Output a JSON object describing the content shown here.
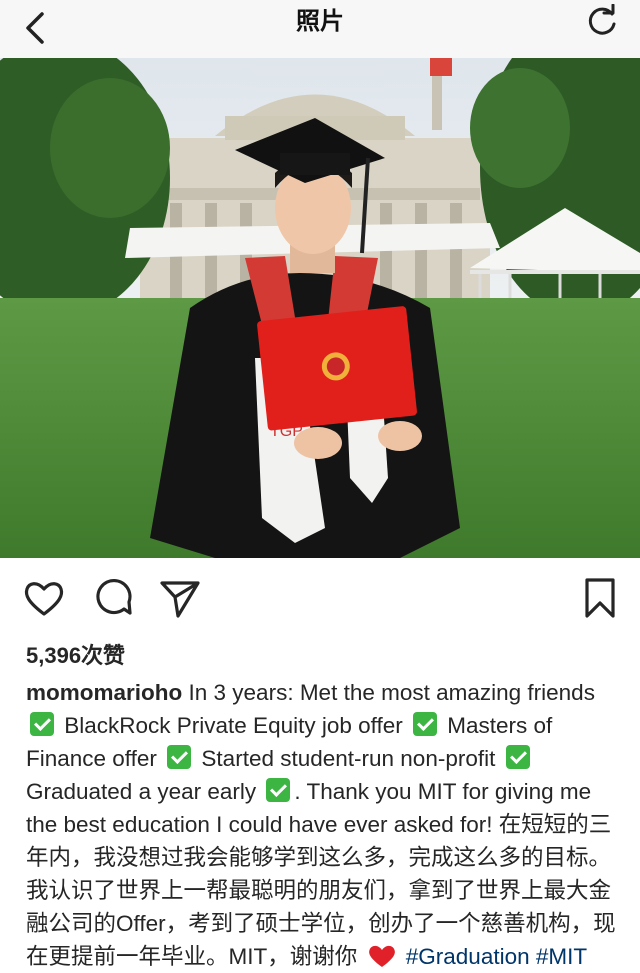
{
  "nav": {
    "title": "照片",
    "back_icon": "chevron-left-icon",
    "refresh_icon": "refresh-icon"
  },
  "photo": {
    "subject": "graduate in cap and gown holding red diploma in front of domed building",
    "board_text": "TGP"
  },
  "actions": {
    "icons": [
      "heart-icon",
      "comment-icon",
      "share-icon",
      "bookmark-icon"
    ]
  },
  "likes": "5,396次赞",
  "caption": {
    "username": "momomarioho",
    "p1": " In 3 years: Met the most amazing friends ",
    "p2": " BlackRock Private Equity job offer ",
    "p3": " Masters of Finance offer ",
    "p4": " Started student-run non-profit ",
    "p5": " Graduated a year early ",
    "p6": ". Thank you MIT for giving me the best education I could have ever asked for! 在短短的三年内，我没想过我会能够学到这么多，完成这么多的目标。我认识了世界上一帮最聪明的朋友们，拿到了世界上最大金融公司的Offer，考到了硕士学位，创办了一个慈善机构，现在更提前一年毕业。MIT，谢谢你 ",
    "hashtags": "#Graduation #MIT"
  },
  "colors": {
    "link": "#003569",
    "check": "#3cb543",
    "heart": "#e0212a"
  }
}
